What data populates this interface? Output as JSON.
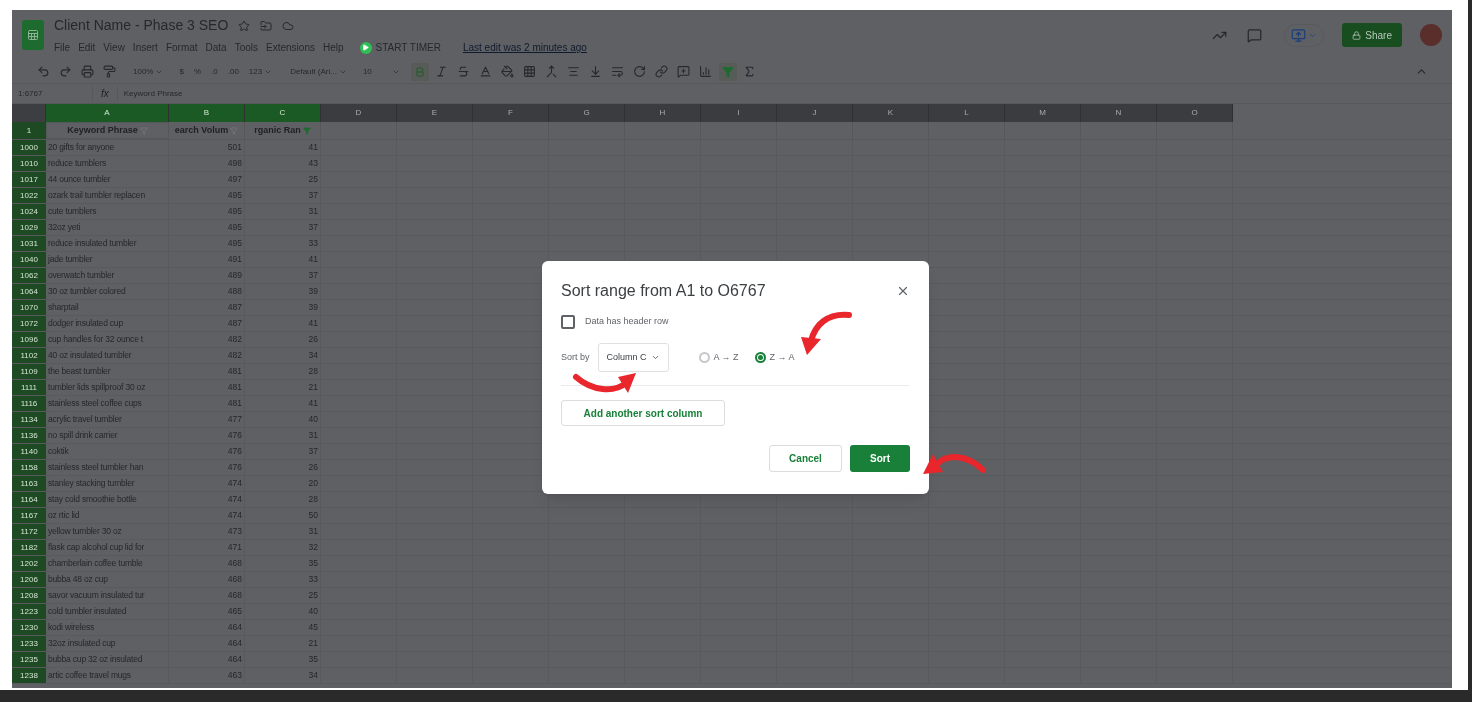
{
  "document": {
    "title": "Client Name - Phase 3 SEO"
  },
  "menu": [
    "File",
    "Edit",
    "View",
    "Insert",
    "Format",
    "Data",
    "Tools",
    "Extensions",
    "Help"
  ],
  "timer_button": "START TIMER",
  "last_edit": "Last edit was 2 minutes ago",
  "share_button": "Share",
  "toolbar": {
    "zoom": "100%",
    "currency": "$",
    "percent": "%",
    "decimal_less": ".0",
    "decimal_more": ".00",
    "number_format": "123",
    "font": "Default (Ari...",
    "font_size": "10"
  },
  "name_box": "1:6767",
  "formula_label": "fx",
  "formula": "Keyword Phrase",
  "columns": [
    {
      "letter": "A",
      "selected": true
    },
    {
      "letter": "B",
      "selected": true
    },
    {
      "letter": "C",
      "selected": true
    },
    {
      "letter": "D",
      "selected": false
    },
    {
      "letter": "E",
      "selected": false
    },
    {
      "letter": "F",
      "selected": false
    },
    {
      "letter": "G",
      "selected": false
    },
    {
      "letter": "H",
      "selected": false
    },
    {
      "letter": "I",
      "selected": false
    },
    {
      "letter": "J",
      "selected": false
    },
    {
      "letter": "K",
      "selected": false
    },
    {
      "letter": "L",
      "selected": false
    },
    {
      "letter": "M",
      "selected": false
    },
    {
      "letter": "N",
      "selected": false
    },
    {
      "letter": "O",
      "selected": false
    }
  ],
  "header_row": {
    "number": "1",
    "cells": [
      {
        "text": "Keyword Phrase",
        "filter_active": false
      },
      {
        "text": "earch Volum",
        "filter_active": false
      },
      {
        "text": "rganic Ran",
        "filter_active": true
      }
    ]
  },
  "rows": [
    {
      "number": "1000",
      "cells": [
        "20 gifts for anyone",
        "501",
        "41"
      ]
    },
    {
      "number": "1010",
      "cells": [
        "reduce tumblers",
        "498",
        "43"
      ]
    },
    {
      "number": "1017",
      "cells": [
        "44 ounce tumbler",
        "497",
        "25"
      ]
    },
    {
      "number": "1022",
      "cells": [
        "ozark trail tumbler replacen",
        "495",
        "37"
      ]
    },
    {
      "number": "1024",
      "cells": [
        "cute tumblers",
        "495",
        "31"
      ]
    },
    {
      "number": "1029",
      "cells": [
        "32oz yeti",
        "495",
        "37"
      ]
    },
    {
      "number": "1031",
      "cells": [
        "reduce insulated tumbler",
        "495",
        "33"
      ]
    },
    {
      "number": "1040",
      "cells": [
        "jade tumbler",
        "491",
        "41"
      ]
    },
    {
      "number": "1062",
      "cells": [
        "overwatch tumbler",
        "489",
        "37"
      ]
    },
    {
      "number": "1064",
      "cells": [
        "30 oz tumbler colored",
        "488",
        "39"
      ]
    },
    {
      "number": "1070",
      "cells": [
        "sharptail",
        "487",
        "39"
      ]
    },
    {
      "number": "1072",
      "cells": [
        "dodger insulated cup",
        "487",
        "41"
      ]
    },
    {
      "number": "1096",
      "cells": [
        "cup handles for 32 ounce t",
        "482",
        "26"
      ]
    },
    {
      "number": "1102",
      "cells": [
        "40 oz insulated tumbler",
        "482",
        "34"
      ]
    },
    {
      "number": "1109",
      "cells": [
        "the beast tumbler",
        "481",
        "28"
      ]
    },
    {
      "number": "1111",
      "cells": [
        "tumbler lids spillproof 30 oz",
        "481",
        "21"
      ]
    },
    {
      "number": "1116",
      "cells": [
        "stainless steel coffee cups",
        "481",
        "41"
      ]
    },
    {
      "number": "1134",
      "cells": [
        "acrylic travel tumbler",
        "477",
        "40"
      ]
    },
    {
      "number": "1136",
      "cells": [
        "no spill drink carrier",
        "476",
        "31"
      ]
    },
    {
      "number": "1140",
      "cells": [
        "coktik",
        "476",
        "37"
      ]
    },
    {
      "number": "1158",
      "cells": [
        "stainless steel tumbler han",
        "476",
        "26"
      ]
    },
    {
      "number": "1163",
      "cells": [
        "stanley stacking tumbler",
        "474",
        "20"
      ]
    },
    {
      "number": "1164",
      "cells": [
        "stay cold smoothie bottle",
        "474",
        "28"
      ]
    },
    {
      "number": "1167",
      "cells": [
        "oz rtic lid",
        "474",
        "50"
      ]
    },
    {
      "number": "1172",
      "cells": [
        "yellow tumbler 30 oz",
        "473",
        "31"
      ]
    },
    {
      "number": "1182",
      "cells": [
        "flask cap alcohol cup lid for",
        "471",
        "32"
      ]
    },
    {
      "number": "1202",
      "cells": [
        "chamberlain coffee tumble",
        "468",
        "35"
      ]
    },
    {
      "number": "1206",
      "cells": [
        "bubba 48 oz cup",
        "468",
        "33"
      ]
    },
    {
      "number": "1208",
      "cells": [
        "savor vacuum insulated tur",
        "468",
        "25"
      ]
    },
    {
      "number": "1223",
      "cells": [
        "cold tumbler insulated",
        "465",
        "40"
      ]
    },
    {
      "number": "1230",
      "cells": [
        "kodi wireless",
        "464",
        "45"
      ]
    },
    {
      "number": "1233",
      "cells": [
        "32oz insulated cup",
        "464",
        "21"
      ]
    },
    {
      "number": "1235",
      "cells": [
        "bubba cup 32 oz insulated",
        "464",
        "35"
      ]
    },
    {
      "number": "1238",
      "cells": [
        "artic coffee travel mugs",
        "463",
        "34"
      ]
    }
  ],
  "dialog": {
    "title": "Sort range from A1 to O6767",
    "header_checkbox": {
      "label": "Data has header row",
      "checked": false
    },
    "sort_by_label": "Sort by",
    "sort_column": "Column C",
    "orders": [
      {
        "label": "A → Z",
        "selected": false
      },
      {
        "label": "Z → A",
        "selected": true
      }
    ],
    "add_button": "Add another sort column",
    "cancel_button": "Cancel",
    "sort_button": "Sort"
  }
}
